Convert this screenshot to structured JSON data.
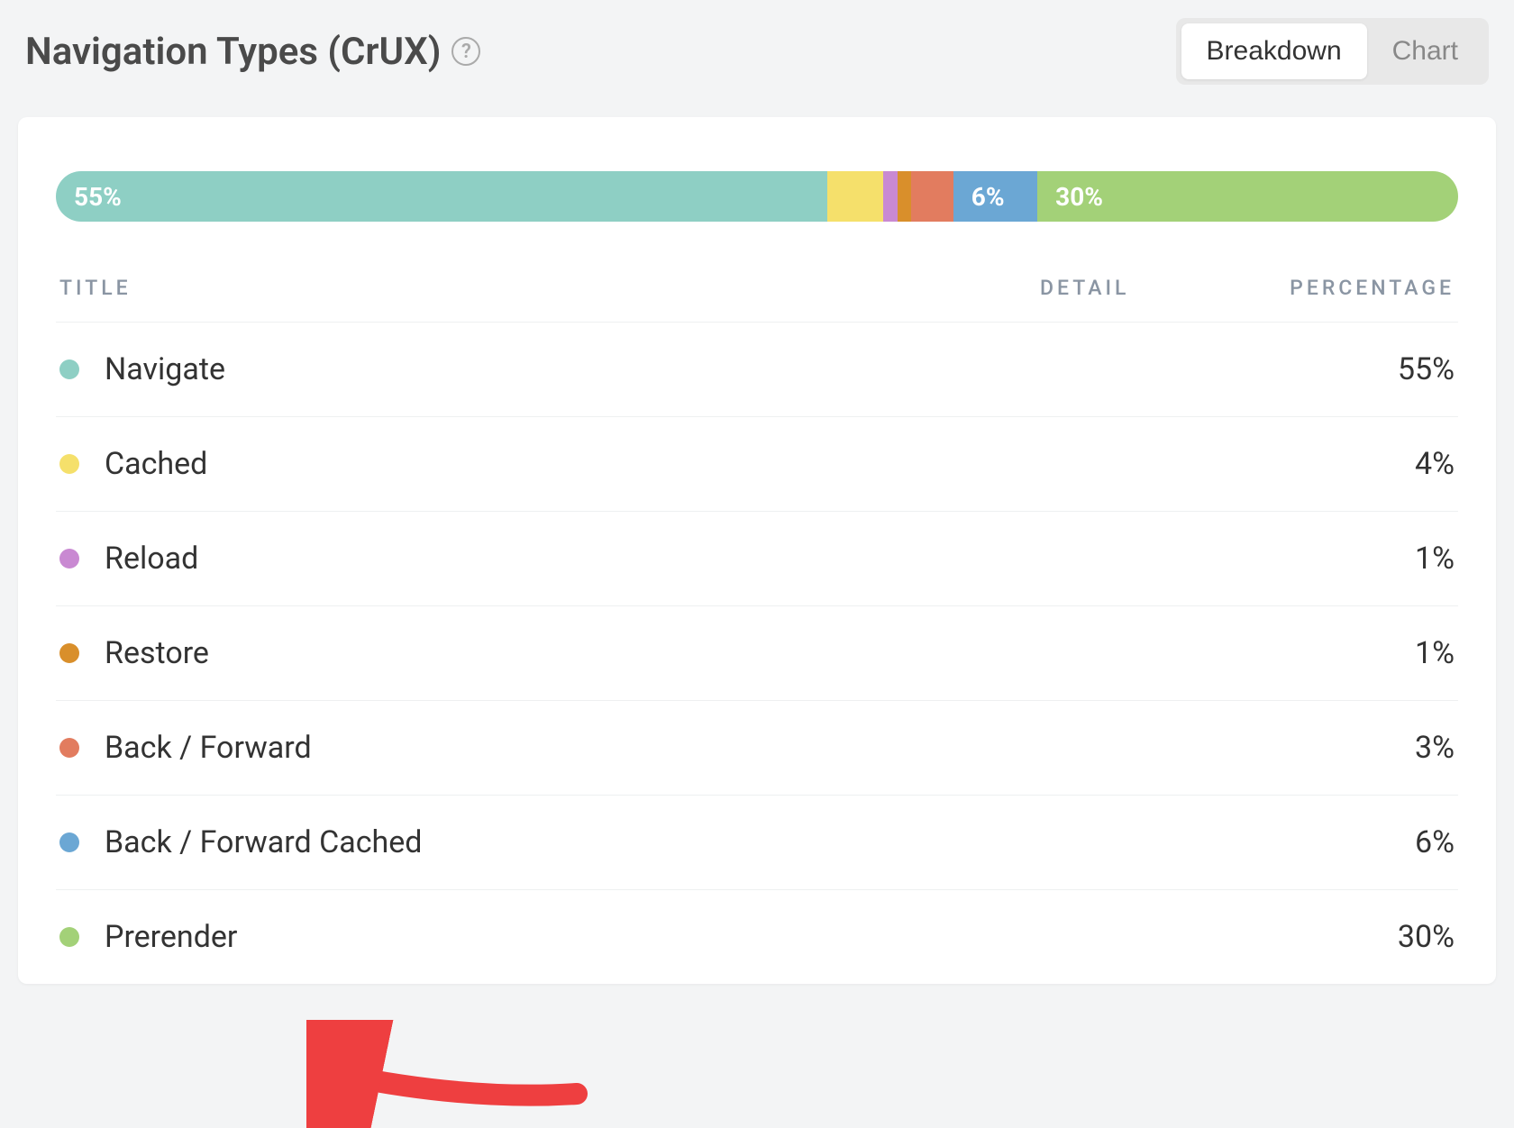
{
  "header": {
    "title": "Navigation Types (CrUX)",
    "help_label": "?",
    "toggle": {
      "breakdown": "Breakdown",
      "chart": "Chart"
    }
  },
  "columns": {
    "title": "TITLE",
    "detail": "DETAIL",
    "percentage": "PERCENTAGE"
  },
  "colors": {
    "navigate": "#8ecfc4",
    "cached": "#f5e06b",
    "reload": "#c989d2",
    "restore": "#d98f2b",
    "back_forward": "#e27c5f",
    "back_forward_cached": "#6ba7d4",
    "prerender": "#a3d178"
  },
  "chart_data": {
    "type": "bar",
    "title": "Navigation Types (CrUX)",
    "categories": [
      "Navigate",
      "Cached",
      "Reload",
      "Restore",
      "Back / Forward",
      "Back / Forward Cached",
      "Prerender"
    ],
    "values": [
      55,
      4,
      1,
      1,
      3,
      6,
      30
    ],
    "xlabel": "",
    "ylabel": "Percentage",
    "ylim": [
      0,
      100
    ],
    "stacked_labels": [
      "55%",
      "",
      "",
      "",
      "",
      "6%",
      "30%"
    ]
  },
  "rows": [
    {
      "title": "Navigate",
      "percentage": "55%",
      "color_key": "navigate"
    },
    {
      "title": "Cached",
      "percentage": "4%",
      "color_key": "cached"
    },
    {
      "title": "Reload",
      "percentage": "1%",
      "color_key": "reload"
    },
    {
      "title": "Restore",
      "percentage": "1%",
      "color_key": "restore"
    },
    {
      "title": "Back / Forward",
      "percentage": "3%",
      "color_key": "back_forward"
    },
    {
      "title": "Back / Forward Cached",
      "percentage": "6%",
      "color_key": "back_forward_cached"
    },
    {
      "title": "Prerender",
      "percentage": "30%",
      "color_key": "prerender"
    }
  ]
}
